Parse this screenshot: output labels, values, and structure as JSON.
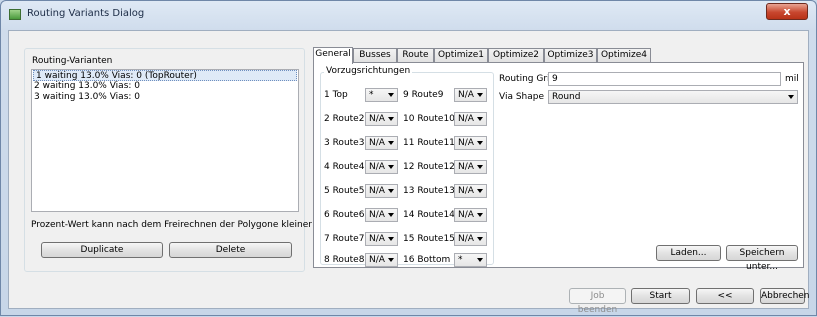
{
  "window": {
    "title": "Routing Variants Dialog",
    "close_glyph": "x"
  },
  "left": {
    "list_label": "Routing-Varianten",
    "items": [
      "1 waiting  13.0% Vias: 0 (TopRouter)",
      "2 waiting  13.0% Vias: 0",
      "3 waiting  13.0% Vias: 0"
    ],
    "note": "Prozent-Wert kann nach dem Freirechnen der Polygone kleiner werden.",
    "duplicate_label": "Duplicate",
    "delete_label": "Delete"
  },
  "tabs": [
    "General",
    "Busses",
    "Route",
    "Optimize1",
    "Optimize2",
    "Optimize3",
    "Optimize4"
  ],
  "general": {
    "group_label": "Vorzugsrichtungen",
    "layers_left": [
      {
        "label": "1 Top",
        "value": "*"
      },
      {
        "label": "2 Route2",
        "value": "N/A"
      },
      {
        "label": "3 Route3",
        "value": "N/A"
      },
      {
        "label": "4 Route4",
        "value": "N/A"
      },
      {
        "label": "5 Route5",
        "value": "N/A"
      },
      {
        "label": "6 Route6",
        "value": "N/A"
      },
      {
        "label": "7 Route7",
        "value": "N/A"
      },
      {
        "label": "8 Route8",
        "value": "N/A"
      }
    ],
    "layers_right": [
      {
        "label": "9 Route9",
        "value": "N/A"
      },
      {
        "label": "10 Route10",
        "value": "N/A"
      },
      {
        "label": "11 Route11",
        "value": "N/A"
      },
      {
        "label": "12 Route12",
        "value": "N/A"
      },
      {
        "label": "13 Route13",
        "value": "N/A"
      },
      {
        "label": "14 Route14",
        "value": "N/A"
      },
      {
        "label": "15 Route15",
        "value": "N/A"
      },
      {
        "label": "16 Bottom",
        "value": "*"
      }
    ],
    "routing_grid_label": "Routing Grid",
    "routing_grid_value": "9",
    "routing_grid_unit": "mil",
    "via_shape_label": "Via Shape",
    "via_shape_value": "Round",
    "load_label": "Laden...",
    "save_as_label": "Speichern unter..."
  },
  "footer": {
    "end_job_label": "Job beenden",
    "start_label": "Start",
    "back_label": "<<",
    "cancel_label": "Abbrechen"
  }
}
